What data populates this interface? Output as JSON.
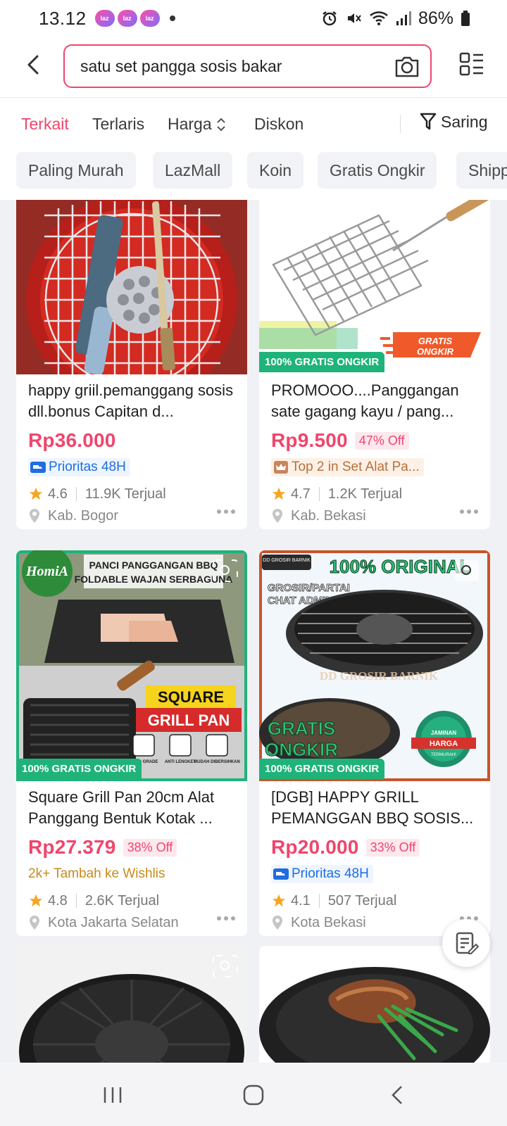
{
  "status_bar": {
    "time": "13.12",
    "app_badges": [
      "laz",
      "laz",
      "laz"
    ],
    "battery": "86%"
  },
  "search": {
    "query": "satu set pangga sosis bakar"
  },
  "sort_tabs": [
    {
      "label": "Terkait",
      "active": true
    },
    {
      "label": "Terlaris",
      "active": false
    },
    {
      "label": "Harga",
      "active": false
    },
    {
      "label": "Diskon",
      "active": false
    }
  ],
  "filter_label": "Saring",
  "chips": [
    "Paling Murah",
    "LazMall",
    "Koin",
    "Gratis Ongkir",
    "Shipp"
  ],
  "free_shipping_label": "100% GRATIS ONGKIR",
  "products": [
    {
      "title": "happy griil.pemanggang sosis dll.bonus Capitan d...",
      "price": "Rp36.000",
      "discount": "",
      "badge_type": "priority",
      "badge": "Prioritas 48H",
      "rating": "4.6",
      "sold": "11.9K Terjual",
      "location": "Kab. Bogor"
    },
    {
      "title": "PROMOOO....Panggangan sate gagang kayu / pang...",
      "price": "Rp9.500",
      "discount": "47% Off",
      "badge_type": "top",
      "badge": "Top 2 in Set Alat Pa...",
      "rating": "4.7",
      "sold": "1.2K Terjual",
      "location": "Kab. Bekasi",
      "image_text": {
        "gratis": "GRATIS",
        "ongkir": "ONGKIR"
      }
    },
    {
      "title": "Square Grill Pan 20cm Alat Panggang Bentuk Kotak ...",
      "price": "Rp27.379",
      "discount": "38% Off",
      "badge_type": "wishlist",
      "badge": "2k+ Tambah ke Wishlis",
      "rating": "4.8",
      "sold": "2.6K Terjual",
      "location": "Kota Jakarta Selatan",
      "image_text": {
        "brand": "HomiA",
        "headline_1": "PANCI PANGGANGAN BBQ",
        "headline_2": "FOLDABLE WAJAN SERBAGUNA",
        "square": "SQUARE",
        "grill_pan": "GRILL PAN",
        "feature_1": "FOOD GRADE",
        "feature_2": "ANTI LENGKET",
        "feature_3": "MUDAH DIBERSIHKAN"
      }
    },
    {
      "title": "[DGB] HAPPY GRILL PEMANGGAN BBQ SOSIS...",
      "price": "Rp20.000",
      "discount": "33% Off",
      "badge_type": "priority",
      "badge": "Prioritas 48H",
      "rating": "4.1",
      "sold": "507 Terjual",
      "location": "Kota Bekasi",
      "image_text": {
        "original": "100% ORIGINAL",
        "grosir": "GROSIR/PARTAI",
        "chat": "CHAT ADMIN",
        "watermark": "DD GROSIR BARNIK",
        "gratis": "GRATIS",
        "ongkir": "ONGKIR",
        "jaminan": "JAMINAN",
        "harga": "HARGA",
        "termurah": "TERMURAH!",
        "seller": "DD GROSIR BARNIK"
      }
    }
  ],
  "colors": {
    "accent": "#f0456d",
    "free_shipping": "#1fb37a",
    "priority": "#1f6de0",
    "star": "#f5a623"
  }
}
